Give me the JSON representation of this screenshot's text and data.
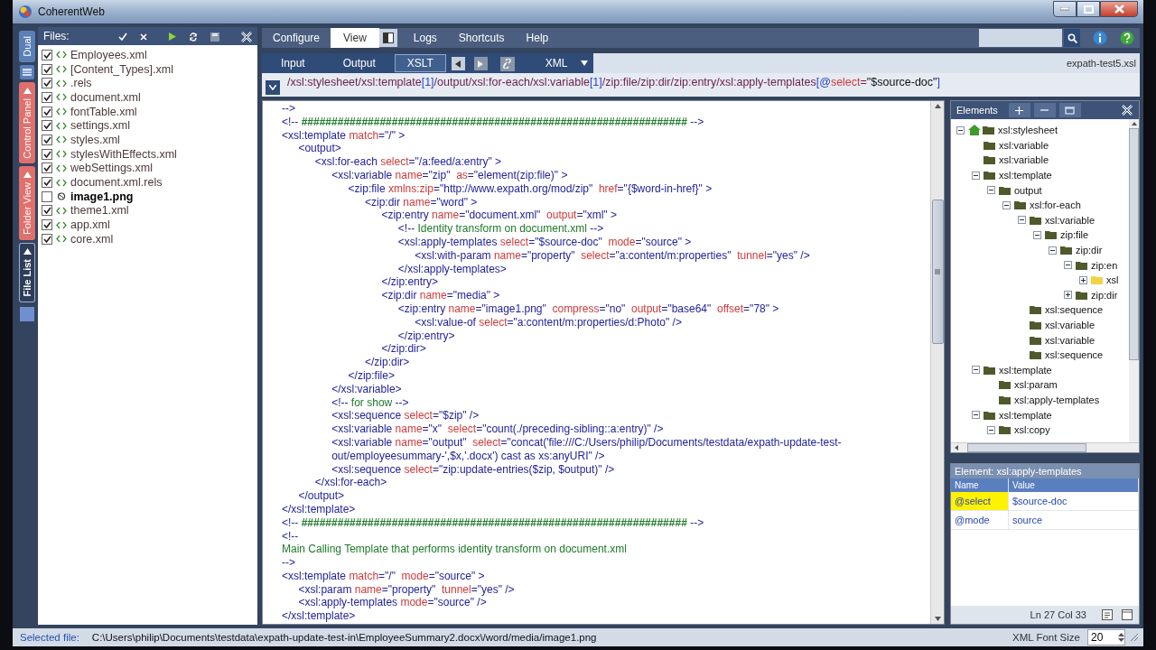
{
  "window": {
    "title": "CoherentWeb"
  },
  "side_tabs": [
    {
      "label": "Dual",
      "selected": false,
      "color": "#5b80b8"
    },
    {
      "label": "Control Panel",
      "selected": false,
      "color": "#e0706c"
    },
    {
      "label": "Folder View",
      "selected": false,
      "color": "#e0706c"
    },
    {
      "label": "File List",
      "selected": true,
      "color": "#2e3d58"
    }
  ],
  "files": {
    "title": "Files:",
    "items": [
      {
        "name": "Employees.xml",
        "kind": "xml",
        "checked": true,
        "selected": false
      },
      {
        "name": "[Content_Types].xml",
        "kind": "xml",
        "checked": true,
        "selected": false
      },
      {
        "name": ".rels",
        "kind": "xml",
        "checked": true,
        "selected": false
      },
      {
        "name": "document.xml",
        "kind": "xml",
        "checked": true,
        "selected": false
      },
      {
        "name": "fontTable.xml",
        "kind": "xml",
        "checked": true,
        "selected": false
      },
      {
        "name": "settings.xml",
        "kind": "xml",
        "checked": true,
        "selected": false
      },
      {
        "name": "styles.xml",
        "kind": "xml",
        "checked": true,
        "selected": false
      },
      {
        "name": "stylesWithEffects.xml",
        "kind": "xml",
        "checked": true,
        "selected": false
      },
      {
        "name": "webSettings.xml",
        "kind": "xml",
        "checked": true,
        "selected": false
      },
      {
        "name": "document.xml.rels",
        "kind": "xml",
        "checked": true,
        "selected": false
      },
      {
        "name": "image1.png",
        "kind": "image",
        "checked": false,
        "selected": true
      },
      {
        "name": "theme1.xml",
        "kind": "xml",
        "checked": true,
        "selected": false
      },
      {
        "name": "app.xml",
        "kind": "xml",
        "checked": true,
        "selected": false
      },
      {
        "name": "core.xml",
        "kind": "xml",
        "checked": true,
        "selected": false
      }
    ]
  },
  "menu": [
    {
      "label": "Configure",
      "selected": false
    },
    {
      "label": "View",
      "selected": true
    },
    {
      "label": "Logs",
      "selected": false
    },
    {
      "label": "Shortcuts",
      "selected": false
    },
    {
      "label": "Help",
      "selected": false
    }
  ],
  "view_tabs": [
    {
      "label": "Input",
      "selected": false
    },
    {
      "label": "Output",
      "selected": false
    },
    {
      "label": "XSLT",
      "selected": true
    }
  ],
  "format": "XML",
  "file_name": "expath-test5.xsl",
  "xpath": [
    {
      "kind": "path",
      "text": "/xsl:stylesheet/xsl:template"
    },
    {
      "kind": "index",
      "text": "[1]"
    },
    {
      "kind": "path",
      "text": "/output/xsl:for-each/xsl:variable"
    },
    {
      "kind": "index",
      "text": "[1]"
    },
    {
      "kind": "path",
      "text": "/zip:file/zip:dir/zip:entry/xsl:apply-templates"
    },
    {
      "kind": "index",
      "text": "[@"
    },
    {
      "kind": "attr",
      "text": "select"
    },
    {
      "kind": "path",
      "text": "="
    },
    {
      "kind": "literal",
      "text": "\"$source-doc\""
    },
    {
      "kind": "index",
      "text": "]"
    }
  ],
  "code": [
    {
      "kind": "comment",
      "text": "-->"
    },
    {
      "kind": "comment",
      "text": "<!-- ################################################################ -->"
    },
    {
      "kind": "code",
      "text": "<xsl:template match=\"/\" >",
      "children": [
        {
          "kind": "code",
          "text": "<output>",
          "children": [
            {
              "kind": "code",
              "text": "<xsl:for-each select=\"/a:feed/a:entry\" >",
              "children": [
                {
                  "kind": "code",
                  "text": "<xsl:variable name=\"zip\"  as=\"element(zip:file)\" >",
                  "children": [
                    {
                      "kind": "code",
                      "text": "<zip:file xmlns:zip=\"http://www.expath.org/mod/zip\"  href=\"{$word-in-href}\" >",
                      "children": [
                        {
                          "kind": "code",
                          "text": "<zip:dir name=\"word\" >",
                          "children": [
                            {
                              "kind": "code",
                              "text": "<zip:entry name=\"document.xml\"  output=\"xml\" >",
                              "children": [
                                {
                                  "kind": "comment",
                                  "text": "<!-- Identity transform on document.xml -->"
                                },
                                {
                                  "kind": "code",
                                  "text": "<xsl:apply-templates select=\"$source-doc\"  mode=\"source\" >",
                                  "children": [
                                    {
                                      "kind": "code",
                                      "text": "<xsl:with-param name=\"property\"  select=\"a:content/m:properties\"  tunnel=\"yes\" />"
                                    }
                                  ]
                                },
                                {
                                  "kind": "code",
                                  "text": "</xsl:apply-templates>"
                                }
                              ]
                            },
                            {
                              "kind": "code",
                              "text": "</zip:entry>"
                            },
                            {
                              "kind": "code",
                              "text": "<zip:dir name=\"media\" >",
                              "children": [
                                {
                                  "kind": "code",
                                  "text": "<zip:entry name=\"image1.png\"  compress=\"no\"  output=\"base64\"  offset=\"78\" >",
                                  "children": [
                                    {
                                      "kind": "code",
                                      "text": "<xsl:value-of select=\"a:content/m:properties/d:Photo\" />"
                                    }
                                  ]
                                },
                                {
                                  "kind": "code",
                                  "text": "</zip:entry>"
                                }
                              ]
                            },
                            {
                              "kind": "code",
                              "text": "</zip:dir>"
                            }
                          ]
                        },
                        {
                          "kind": "code",
                          "text": "</zip:dir>"
                        }
                      ]
                    },
                    {
                      "kind": "code",
                      "text": "</zip:file>"
                    }
                  ]
                },
                {
                  "kind": "code",
                  "text": "</xsl:variable>"
                },
                {
                  "kind": "comment",
                  "text": "<!-- for show -->"
                },
                {
                  "kind": "code",
                  "text": "<xsl:sequence select=\"$zip\" />"
                },
                {
                  "kind": "code",
                  "text": "<xsl:variable name=\"x\"  select=\"count(./preceding-sibling::a:entry)\" />"
                },
                {
                  "kind": "code",
                  "text": "<xsl:variable name=\"output\"  select=\"concat('file:///C:/Users/philip/Documents/testdata/expath-update-test-"
                },
                {
                  "kind": "code",
                  "text": "out/employeesummary-',$x,'.docx') cast as xs:anyURI\" />"
                },
                {
                  "kind": "code",
                  "text": "<xsl:sequence select=\"zip:update-entries($zip, $output)\" />"
                }
              ]
            },
            {
              "kind": "code",
              "text": "</xsl:for-each>"
            }
          ]
        },
        {
          "kind": "code",
          "text": "</output>"
        }
      ]
    },
    {
      "kind": "code",
      "text": "</xsl:template>"
    },
    {
      "kind": "comment",
      "text": "<!-- ################################################################ -->"
    },
    {
      "kind": "comment",
      "text": "<!--"
    },
    {
      "kind": "comment",
      "text": "Main Calling Template that performs identity transform on document.xml"
    },
    {
      "kind": "comment",
      "text": "-->"
    },
    {
      "kind": "code",
      "text": "<xsl:template match=\"/\"  mode=\"source\" >",
      "children": [
        {
          "kind": "code",
          "text": "<xsl:param name=\"property\"  tunnel=\"yes\" />"
        },
        {
          "kind": "code",
          "text": "<xsl:apply-templates mode=\"source\" />"
        }
      ]
    },
    {
      "kind": "code",
      "text": "</xsl:template>"
    }
  ],
  "elements": {
    "title": "Elements",
    "tree": [
      {
        "label": "xsl:stylesheet",
        "expanded": true,
        "selected": false,
        "children": [
          {
            "label": "xsl:variable",
            "selected": false
          },
          {
            "label": "xsl:variable",
            "selected": false
          },
          {
            "label": "xsl:template",
            "expanded": true,
            "selected": false,
            "children": [
              {
                "label": "output",
                "expanded": true,
                "selected": false,
                "children": [
                  {
                    "label": "xsl:for-each",
                    "expanded": true,
                    "selected": false,
                    "children": [
                      {
                        "label": "xsl:variable",
                        "expanded": true,
                        "selected": false,
                        "children": [
                          {
                            "label": "zip:file",
                            "expanded": true,
                            "selected": false,
                            "children": [
                              {
                                "label": "zip:dir",
                                "expanded": true,
                                "selected": false,
                                "children": [
                                  {
                                    "label": "zip:en",
                                    "expanded": true,
                                    "selected": false,
                                    "children": [
                                      {
                                        "label": "xsl",
                                        "expanded": false,
                                        "selected": true
                                      }
                                    ]
                                  },
                                  {
                                    "label": "zip:dir",
                                    "expanded": false,
                                    "selected": false
                                  }
                                ]
                              }
                            ]
                          }
                        ]
                      },
                      {
                        "label": "xsl:sequence",
                        "selected": false
                      },
                      {
                        "label": "xsl:variable",
                        "selected": false
                      },
                      {
                        "label": "xsl:variable",
                        "selected": false
                      },
                      {
                        "label": "xsl:sequence",
                        "selected": false
                      }
                    ]
                  }
                ]
              }
            ]
          },
          {
            "label": "xsl:template",
            "expanded": true,
            "selected": false,
            "children": [
              {
                "label": "xsl:param",
                "selected": false
              },
              {
                "label": "xsl:apply-templates",
                "selected": false
              }
            ]
          },
          {
            "label": "xsl:template",
            "expanded": true,
            "selected": false,
            "children": [
              {
                "label": "xsl:copy",
                "expanded": true,
                "selected": false
              }
            ]
          }
        ]
      }
    ]
  },
  "properties": {
    "title": "Element: xsl:apply-templates",
    "columns": [
      "Name",
      "Value"
    ],
    "rows": [
      {
        "name": "@select",
        "value": "$source-doc",
        "selected": true
      },
      {
        "name": "@mode",
        "value": "source",
        "selected": false
      }
    ]
  },
  "cursor": "Ln 27 Col 33",
  "status_bar": {
    "label": "Selected file:",
    "path": "C:\\Users\\philip\\Documents\\testdata\\expath-update-test-in\\EmployeeSummary2.docx\\/word/media/image1.png",
    "font_size_label": "XML Font Size",
    "font_size": "20"
  }
}
